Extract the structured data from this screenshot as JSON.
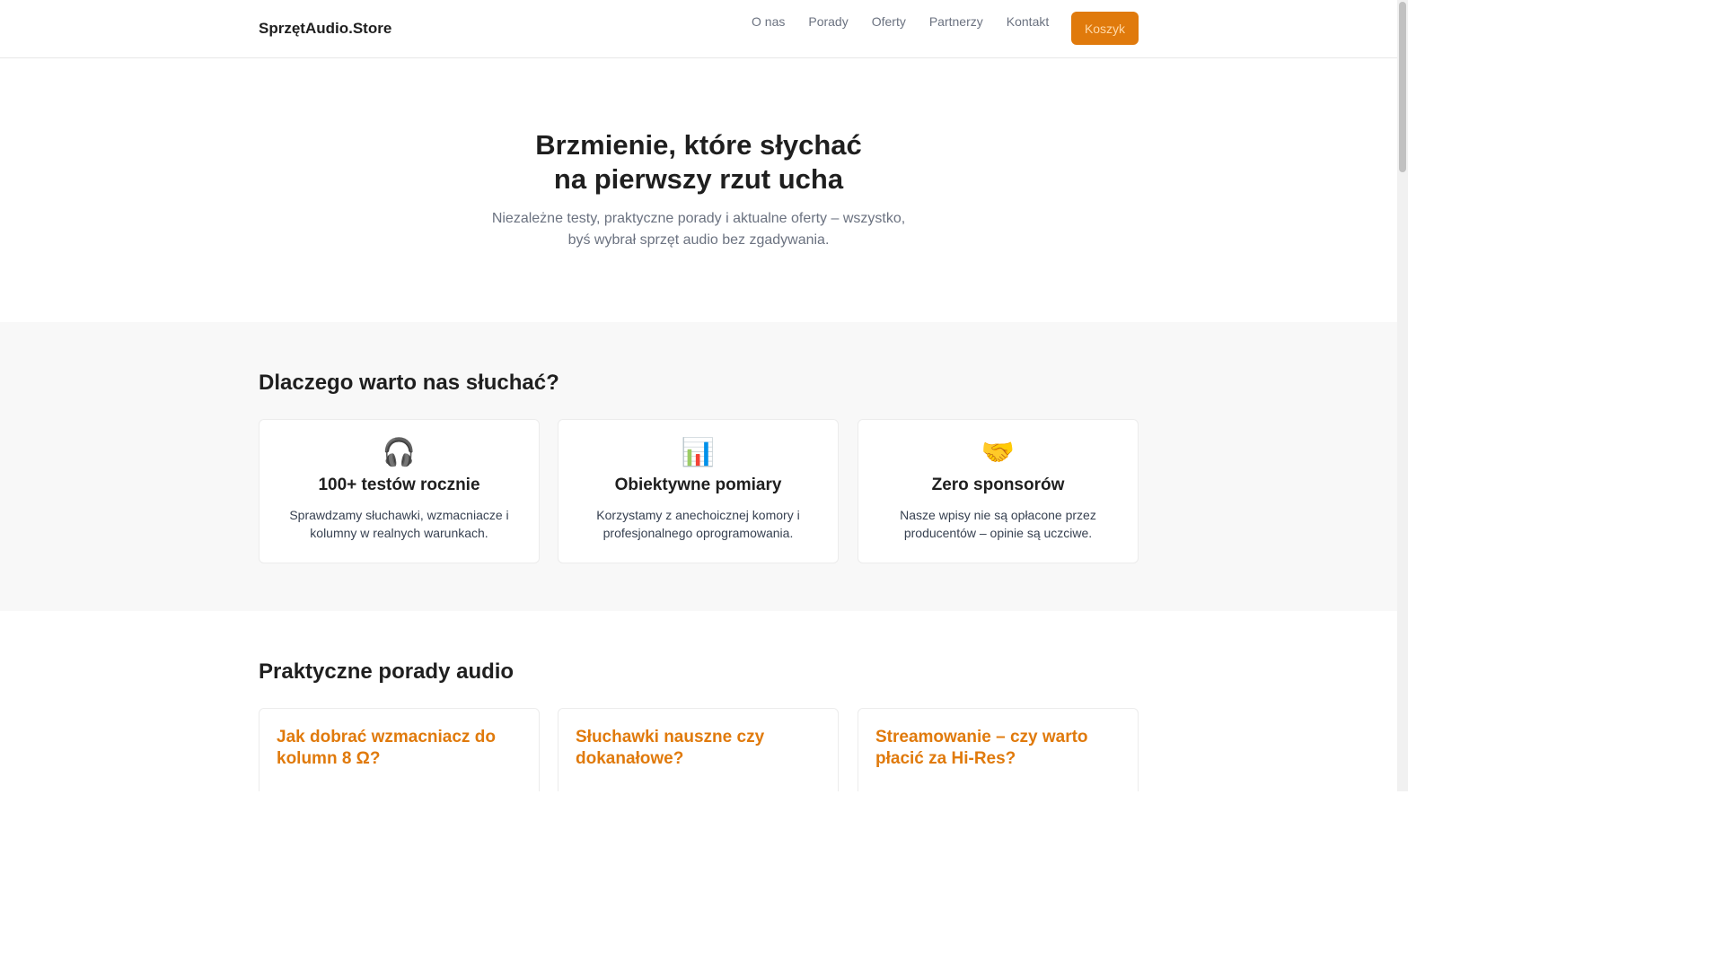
{
  "header": {
    "brand": "SprzętAudio.Store",
    "nav": [
      "O nas",
      "Porady",
      "Oferty",
      "Partnerzy",
      "Kontakt"
    ],
    "cart_label": "Koszyk"
  },
  "hero": {
    "title_line1": "Brzmienie, które słychać",
    "title_line2": "na pierwszy rzut ucha",
    "subtitle": "Niezależne testy, praktyczne porady i aktualne oferty – wszystko, byś wybrał sprzęt audio bez zgadywania."
  },
  "why": {
    "title": "Dlaczego warto nas słuchać?",
    "cards": [
      {
        "icon": "headphones-icon",
        "glyph": "🎧",
        "title": "100+ testów rocznie",
        "text": "Sprawdzamy słuchawki, wzmacniacze i kolumny w realnych warunkach."
      },
      {
        "icon": "bar-chart-icon",
        "glyph": "📊",
        "title": "Obiektywne pomiary",
        "text": "Korzystamy z anechoicznej komory i profesjonalnego oprogramowania."
      },
      {
        "icon": "handshake-icon",
        "glyph": "🤝",
        "title": "Zero sponsorów",
        "text": "Nasze wpisy nie są opłacone przez producentów – opinie są uczciwe."
      }
    ]
  },
  "tips": {
    "title": "Praktyczne porady audio",
    "articles": [
      "Jak dobrać wzmacniacz do kolumn 8 Ω?",
      "Słuchawki nauszne czy dokanałowe?",
      "Streamowanie – czy warto płacić za Hi-Res?"
    ]
  },
  "colors": {
    "accent": "#e07a0c",
    "muted_text": "#6b7280",
    "section_bg": "#f8f8f8"
  }
}
